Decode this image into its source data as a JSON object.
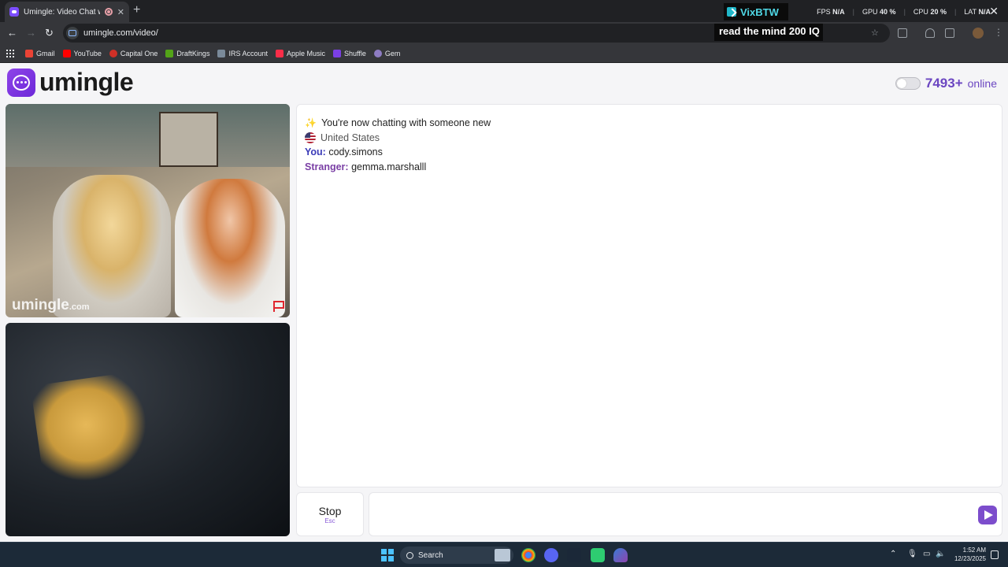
{
  "browser": {
    "tab": {
      "title": "Umingle: Video Chat with S",
      "close_glyph": "✕"
    },
    "new_tab_glyph": "+",
    "url": "umingle.com/video/",
    "nav": {
      "back": "←",
      "forward": "→",
      "reload": "↻"
    },
    "bookmarks": [
      {
        "label": "Gmail",
        "color": "#ea4335"
      },
      {
        "label": "YouTube",
        "color": "#ff0000"
      },
      {
        "label": "Capital One",
        "color": "#d03027"
      },
      {
        "label": "DraftKings",
        "color": "#53a318"
      },
      {
        "label": "IRS Account",
        "color": "#7a8a9a"
      },
      {
        "label": "Apple Music",
        "color": "#fa2d48"
      },
      {
        "label": "Shuffle",
        "color": "#7b3fe4"
      },
      {
        "label": "Gem",
        "color": "#8e7cc3"
      }
    ]
  },
  "stream_overlay": {
    "name": "VixBTW",
    "title": "read the mind 200 IQ",
    "stats": [
      {
        "label": "FPS",
        "value": "N/A"
      },
      {
        "label": "GPU",
        "value": "40 %"
      },
      {
        "label": "CPU",
        "value": "20 %"
      },
      {
        "label": "LAT",
        "value": "N/A"
      }
    ]
  },
  "site": {
    "logo_text": "umingle",
    "online_count": "7493+",
    "online_label": "online",
    "video_watermark": "umingle",
    "video_watermark_suffix": ".com"
  },
  "chat": {
    "system_message": "You're now chatting with someone new",
    "country": "United States",
    "you_label": "You:",
    "you_name": "cody.simons",
    "stranger_label": "Stranger:",
    "stranger_name": "gemma.marshalll"
  },
  "controls": {
    "stop_label": "Stop",
    "stop_key": "Esc",
    "message_placeholder": ""
  },
  "taskbar": {
    "search_label": "Search",
    "time": "1:52 AM",
    "date": "12/23/2025"
  }
}
